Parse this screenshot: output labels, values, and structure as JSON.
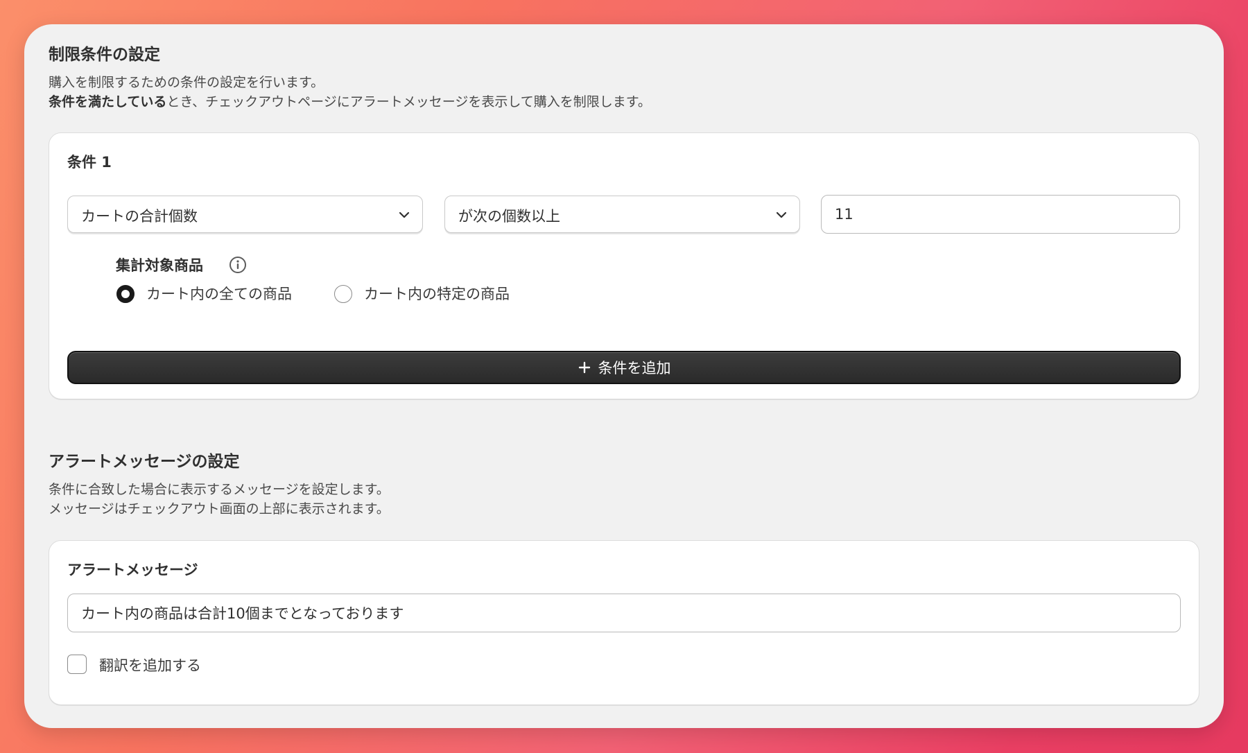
{
  "restriction": {
    "title": "制限条件の設定",
    "desc_line1": "購入を制限するための条件の設定を行います。",
    "desc_line2_bold": "条件を満たしている",
    "desc_line2_rest": "とき、チェックアウトページにアラートメッセージを表示して購入を制限します。",
    "condition": {
      "title": "条件 1",
      "field_select": "カートの合計個数",
      "operator_select": "が次の個数以上",
      "value": "11",
      "scope_label": "集計対象商品",
      "scope_options": [
        {
          "label": "カート内の全ての商品",
          "selected": true
        },
        {
          "label": "カート内の特定の商品",
          "selected": false
        }
      ]
    },
    "add_button_label": "条件を追加"
  },
  "alert": {
    "title": "アラートメッセージの設定",
    "desc_line1": "条件に合致した場合に表示するメッセージを設定します。",
    "desc_line2": "メッセージはチェックアウト画面の上部に表示されます。",
    "card_title": "アラートメッセージ",
    "message_value": "カート内の商品は合計10個までとなっております",
    "translate_label": "翻訳を追加する",
    "translate_checked": false
  }
}
